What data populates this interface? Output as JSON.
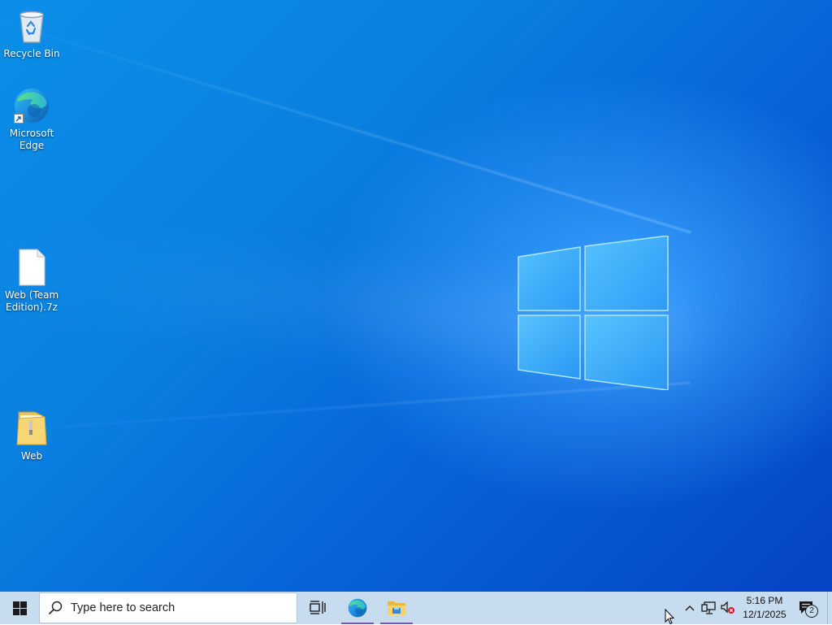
{
  "desktop": {
    "icons": [
      {
        "label": "Recycle Bin",
        "icon": "recycle-bin-icon"
      },
      {
        "label": "Microsoft Edge",
        "icon": "edge-icon"
      },
      {
        "label": "Web (Team Edition).7z",
        "icon": "file-icon"
      },
      {
        "label": "Web",
        "icon": "folder-icon"
      }
    ]
  },
  "taskbar": {
    "start_icon": "windows-logo-icon",
    "search": {
      "placeholder": "Type here to search",
      "icon": "search-icon"
    },
    "task_view_icon": "task-view-icon",
    "apps": [
      {
        "name": "Microsoft Edge",
        "icon": "edge-icon",
        "running": true
      },
      {
        "name": "File Explorer",
        "icon": "folder-icon",
        "running": true
      }
    ],
    "tray": {
      "overflow_icon": "chevron-up-icon",
      "network_icon": "network-icon",
      "volume_icon": "volume-muted-icon",
      "time": "5:16 PM",
      "date": "12/1/2025",
      "notifications_icon": "notification-icon",
      "notification_count": "2"
    }
  },
  "colors": {
    "taskbar_bg": "#c8dcef",
    "running_indicator": "#7a55b0",
    "desktop_accent": "#0a7fe0"
  }
}
